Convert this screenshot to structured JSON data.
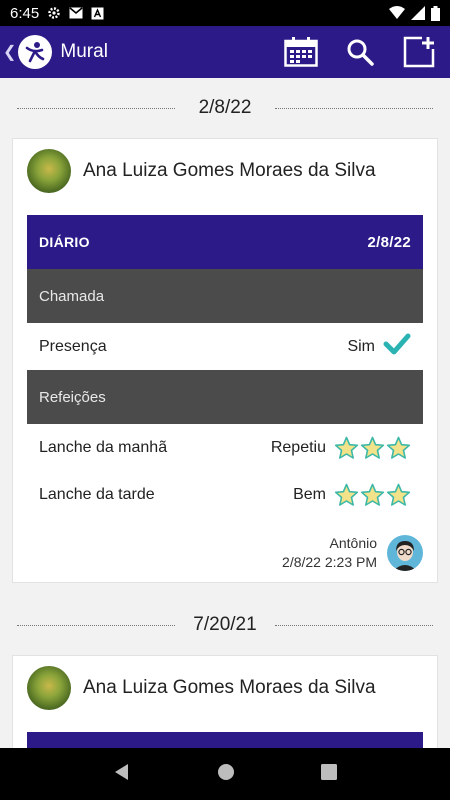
{
  "status_bar": {
    "time": "6:45"
  },
  "app_bar": {
    "title": "Mural"
  },
  "posts": [
    {
      "date": "2/8/22",
      "student": "Ana Luiza Gomes Moraes da Silva",
      "diary": {
        "label": "DIÁRIO",
        "date": "2/8/22",
        "sections": [
          {
            "title": "Chamada",
            "items": [
              {
                "label": "Presença",
                "value": "Sim",
                "indicator": "check",
                "stars": 0
              }
            ]
          },
          {
            "title": "Refeições",
            "items": [
              {
                "label": "Lanche da manhã",
                "value": "Repetiu",
                "indicator": "stars",
                "stars": 3
              },
              {
                "label": "Lanche da tarde",
                "value": "Bem",
                "indicator": "stars",
                "stars": 3
              }
            ]
          }
        ]
      },
      "author": "Antônio",
      "timestamp": "2/8/22 2:23 PM"
    },
    {
      "date": "7/20/21",
      "student": "Ana Luiza Gomes Moraes da Silva"
    }
  ],
  "colors": {
    "primary": "#2c1a88",
    "section": "#4b4b4b",
    "check": "#2bb3b3",
    "star": "#f2e28a"
  }
}
